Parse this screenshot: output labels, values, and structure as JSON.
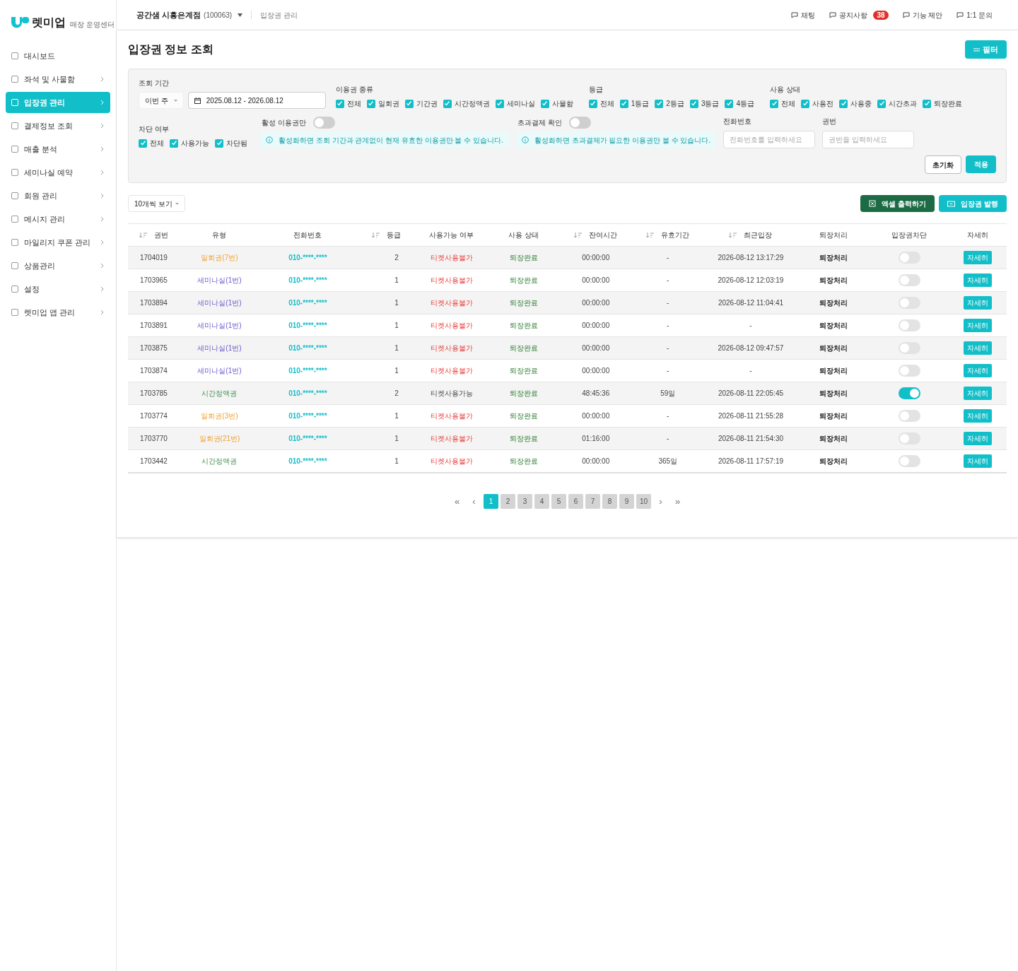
{
  "brand": {
    "name": "렛미업",
    "subtitle": "매장 운영센터"
  },
  "sidebar": {
    "items": [
      {
        "label": "대시보드",
        "selected": false,
        "has_submenu": false
      },
      {
        "label": "좌석 및 사물함",
        "selected": false,
        "has_submenu": true
      },
      {
        "label": "입장권 관리",
        "selected": true,
        "has_submenu": true
      },
      {
        "label": "결제정보 조회",
        "selected": false,
        "has_submenu": true
      },
      {
        "label": "매출 분석",
        "selected": false,
        "has_submenu": true
      },
      {
        "label": "세미나실 예약",
        "selected": false,
        "has_submenu": true
      },
      {
        "label": "회원 관리",
        "selected": false,
        "has_submenu": true
      },
      {
        "label": "메시지 관리",
        "selected": false,
        "has_submenu": true
      },
      {
        "label": "마일리지 쿠폰 관리",
        "selected": false,
        "has_submenu": true
      },
      {
        "label": "상품관리",
        "selected": false,
        "has_submenu": true
      },
      {
        "label": "설정",
        "selected": false,
        "has_submenu": true
      },
      {
        "label": "렛미업 앱 관리",
        "selected": false,
        "has_submenu": true
      }
    ]
  },
  "header": {
    "store": "공간샘 시흥은계점",
    "store_code": "(100063)",
    "breadcrumb": "입장권 관리",
    "links": [
      {
        "label": "채팅"
      },
      {
        "label": "공지사항",
        "badge": "38"
      },
      {
        "label": "기능 제안"
      },
      {
        "label": "1:1 문의"
      }
    ]
  },
  "page": {
    "title": "입장권 정보 조회",
    "filter_button": "필터"
  },
  "filters": {
    "period": {
      "label": "조회 기간",
      "preset": "이번 주",
      "range": "2025.08.12 - 2026.08.12"
    },
    "groups": [
      {
        "label": "이용권 종류",
        "options": [
          {
            "label": "전체",
            "checked": true
          },
          {
            "label": "일회권",
            "checked": true
          },
          {
            "label": "기간권",
            "checked": true
          },
          {
            "label": "시간정액권",
            "checked": true
          },
          {
            "label": "세미나실",
            "checked": true
          },
          {
            "label": "사물함",
            "checked": true
          }
        ]
      },
      {
        "label": "등급",
        "options": [
          {
            "label": "전체",
            "checked": true
          },
          {
            "label": "1등급",
            "checked": true
          },
          {
            "label": "2등급",
            "checked": true
          },
          {
            "label": "3등급",
            "checked": true
          },
          {
            "label": "4등급",
            "checked": true
          }
        ]
      },
      {
        "label": "사용 상태",
        "options": [
          {
            "label": "전체",
            "checked": true
          },
          {
            "label": "사용전",
            "checked": true
          },
          {
            "label": "사용중",
            "checked": true
          },
          {
            "label": "시간초과",
            "checked": true
          },
          {
            "label": "퇴장완료",
            "checked": true
          }
        ]
      }
    ],
    "block": {
      "label": "차단 여부",
      "options": [
        {
          "label": "전체",
          "checked": true
        },
        {
          "label": "사용가능",
          "checked": true
        },
        {
          "label": "차단됨",
          "checked": true
        }
      ]
    },
    "toggles": [
      {
        "label": "활성 이용권만",
        "on": false,
        "info": "활성화하면 조회 기간과 관계없이 현재 유효한 이용권만 볼 수 있습니다."
      },
      {
        "label": "초과결제 확인",
        "on": false,
        "info": "활성화하면 초과결제가 필요한 이용권만 볼 수 있습니다."
      }
    ],
    "fields": [
      {
        "label": "전화번호",
        "placeholder": "전화번호를 입력하세요"
      },
      {
        "label": "권번",
        "placeholder": "권번을 입력하세요"
      }
    ],
    "reset": "초기화",
    "apply": "적용"
  },
  "toolbar": {
    "page_size": "10개씩 보기",
    "excel": "엑셀 출력하기",
    "issue": "입장권 발행"
  },
  "table": {
    "columns": [
      {
        "label": "권번",
        "sortable": true
      },
      {
        "label": "유형",
        "sortable": false
      },
      {
        "label": "전화번호",
        "sortable": false
      },
      {
        "label": "등급",
        "sortable": true
      },
      {
        "label": "사용가능 여부",
        "sortable": false
      },
      {
        "label": "사용 상태",
        "sortable": false
      },
      {
        "label": "잔여시간",
        "sortable": true
      },
      {
        "label": "유효기간",
        "sortable": true
      },
      {
        "label": "최근입장",
        "sortable": true
      },
      {
        "label": "퇴장처리",
        "sortable": false
      },
      {
        "label": "입장권차단",
        "sortable": false
      },
      {
        "label": "자세히",
        "sortable": false
      }
    ],
    "rows": [
      {
        "id": "1704019",
        "type": "일회권(7번)",
        "kind": "one_time",
        "phone": "010-****-****",
        "grade": "2",
        "availability": "티켓사용불가",
        "available": false,
        "status": "퇴장완료",
        "remaining": "00:00:00",
        "validity": "-",
        "last_entry": "2026-08-12 13:17:29",
        "exit": "퇴장처리",
        "blocked": false,
        "detail": "자세히"
      },
      {
        "id": "1703965",
        "type": "세미나실(1번)",
        "kind": "seminar",
        "phone": "010-****-****",
        "grade": "1",
        "availability": "티켓사용불가",
        "available": false,
        "status": "퇴장완료",
        "remaining": "00:00:00",
        "validity": "-",
        "last_entry": "2026-08-12 12:03:19",
        "exit": "퇴장처리",
        "blocked": false,
        "detail": "자세히"
      },
      {
        "id": "1703894",
        "type": "세미나실(1번)",
        "kind": "seminar",
        "phone": "010-****-****",
        "grade": "1",
        "availability": "티켓사용불가",
        "available": false,
        "status": "퇴장완료",
        "remaining": "00:00:00",
        "validity": "-",
        "last_entry": "2026-08-12 11:04:41",
        "exit": "퇴장처리",
        "blocked": false,
        "detail": "자세히"
      },
      {
        "id": "1703891",
        "type": "세미나실(1번)",
        "kind": "seminar",
        "phone": "010-****-****",
        "grade": "1",
        "availability": "티켓사용불가",
        "available": false,
        "status": "퇴장완료",
        "remaining": "00:00:00",
        "validity": "-",
        "last_entry": "-",
        "exit": "퇴장처리",
        "blocked": false,
        "detail": "자세히"
      },
      {
        "id": "1703875",
        "type": "세미나실(1번)",
        "kind": "seminar",
        "phone": "010-****-****",
        "grade": "1",
        "availability": "티켓사용불가",
        "available": false,
        "status": "퇴장완료",
        "remaining": "00:00:00",
        "validity": "-",
        "last_entry": "2026-08-12 09:47:57",
        "exit": "퇴장처리",
        "blocked": false,
        "detail": "자세히"
      },
      {
        "id": "1703874",
        "type": "세미나실(1번)",
        "kind": "seminar",
        "phone": "010-****-****",
        "grade": "1",
        "availability": "티켓사용불가",
        "available": false,
        "status": "퇴장완료",
        "remaining": "00:00:00",
        "validity": "-",
        "last_entry": "-",
        "exit": "퇴장처리",
        "blocked": false,
        "detail": "자세히"
      },
      {
        "id": "1703785",
        "type": "시간정액권",
        "kind": "time_pass",
        "phone": "010-****-****",
        "grade": "2",
        "availability": "티켓사용가능",
        "available": true,
        "status": "퇴장완료",
        "remaining": "48:45:36",
        "validity": "59일",
        "last_entry": "2026-08-11 22:05:45",
        "exit": "퇴장처리",
        "blocked": true,
        "detail": "자세히"
      },
      {
        "id": "1703774",
        "type": "일회권(3번)",
        "kind": "one_time",
        "phone": "010-****-****",
        "grade": "1",
        "availability": "티켓사용불가",
        "available": false,
        "status": "퇴장완료",
        "remaining": "00:00:00",
        "validity": "-",
        "last_entry": "2026-08-11 21:55:28",
        "exit": "퇴장처리",
        "blocked": false,
        "detail": "자세히"
      },
      {
        "id": "1703770",
        "type": "일회권(21번)",
        "kind": "one_time",
        "phone": "010-****-****",
        "grade": "1",
        "availability": "티켓사용불가",
        "available": false,
        "status": "퇴장완료",
        "remaining": "01:16:00",
        "validity": "-",
        "last_entry": "2026-08-11 21:54:30",
        "exit": "퇴장처리",
        "blocked": false,
        "detail": "자세히"
      },
      {
        "id": "1703442",
        "type": "시간정액권",
        "kind": "time_pass",
        "phone": "010-****-****",
        "grade": "1",
        "availability": "티켓사용불가",
        "available": false,
        "status": "퇴장완료",
        "remaining": "00:00:00",
        "validity": "365일",
        "last_entry": "2026-08-11 17:57:19",
        "exit": "퇴장처리",
        "blocked": false,
        "detail": "자세히"
      }
    ]
  },
  "pagination": {
    "first": "«",
    "prev": "‹",
    "pages": [
      {
        "label": "1",
        "selected": true
      },
      {
        "label": "2",
        "selected": false
      },
      {
        "label": "3",
        "selected": false
      },
      {
        "label": "4",
        "selected": false
      },
      {
        "label": "5",
        "selected": false
      },
      {
        "label": "6",
        "selected": false
      },
      {
        "label": "7",
        "selected": false
      },
      {
        "label": "8",
        "selected": false
      },
      {
        "label": "9",
        "selected": false
      },
      {
        "label": "10",
        "selected": false
      }
    ],
    "next": "›",
    "last": "»"
  }
}
